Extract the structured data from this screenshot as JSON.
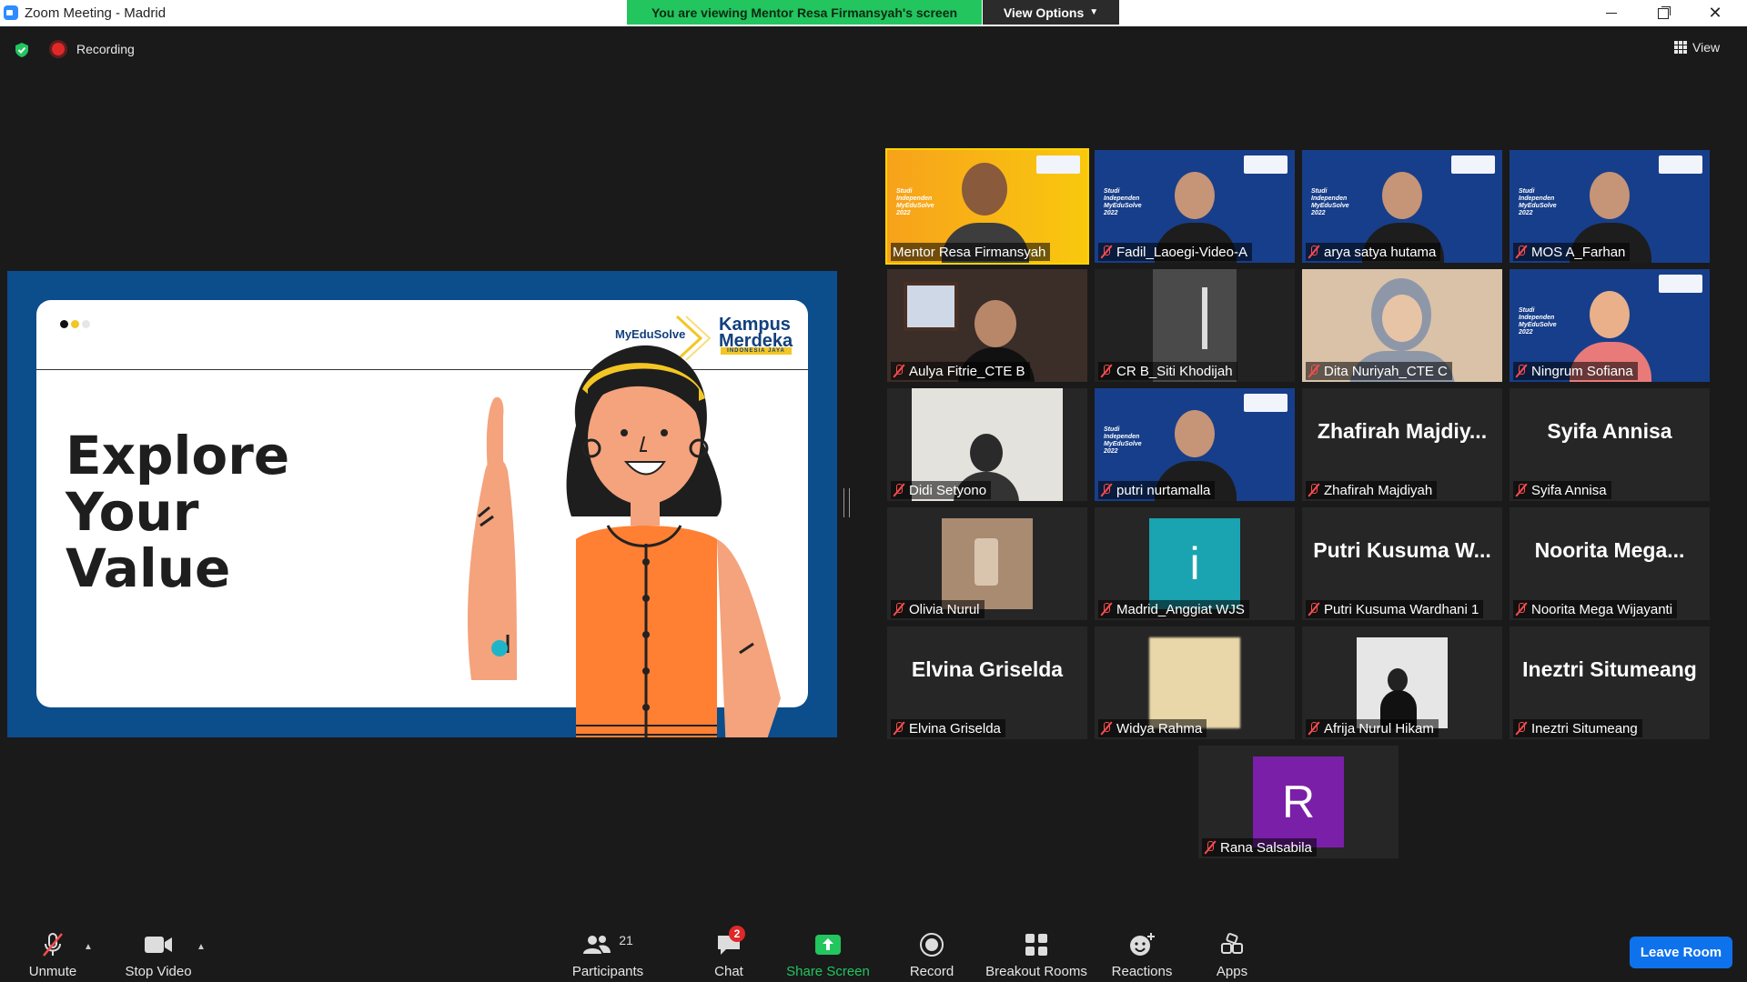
{
  "window": {
    "title": "Zoom Meeting - Madrid"
  },
  "banner": {
    "text": "You are viewing Mentor Resa Firmansyah's screen",
    "view_options": "View Options"
  },
  "status": {
    "recording": "Recording",
    "view": "View"
  },
  "slide": {
    "brand1": "MyEduSolve",
    "brand2_line1": "Kampus",
    "brand2_line2": "Merdeka",
    "brand2_sub": "INDONESIA JAYA",
    "headline": "Explore\nYour\nValue"
  },
  "participants": [
    {
      "name": "Mentor Resa Firmansyah",
      "muted": false,
      "active": true,
      "video": "yellow"
    },
    {
      "name": "Fadil_Laoegi-Video-A",
      "muted": true,
      "video": "blue"
    },
    {
      "name": "arya satya hutama",
      "muted": true,
      "video": "blue"
    },
    {
      "name": "MOS A_Farhan",
      "muted": true,
      "video": "blue"
    },
    {
      "name": "Aulya Fitrie_CTE B",
      "muted": true,
      "video": "room"
    },
    {
      "name": "CR B_Siti Khodijah",
      "muted": true,
      "video": "dark"
    },
    {
      "name": "Dita Nuriyah_CTE C",
      "muted": true,
      "video": "light"
    },
    {
      "name": "Ningrum Sofiana",
      "muted": true,
      "video": "blue-pink"
    },
    {
      "name": "Didi Setyono",
      "muted": true,
      "video": "small-white"
    },
    {
      "name": "putri nurtamalla",
      "muted": true,
      "video": "blue"
    },
    {
      "name": "Zhafirah Majdiyah",
      "muted": true,
      "video": "none",
      "big": "Zhafirah  Majdiy..."
    },
    {
      "name": "Syifa Annisa",
      "muted": true,
      "video": "none",
      "big": "Syifa Annisa"
    },
    {
      "name": "Olivia Nurul",
      "muted": true,
      "video": "small-brown"
    },
    {
      "name": "Madrid_Anggiat WJS",
      "muted": true,
      "video": "small-teal",
      "avatar": "i"
    },
    {
      "name": "Putri Kusuma Wardhani 1",
      "muted": true,
      "video": "none",
      "big": "Putri Kusuma W..."
    },
    {
      "name": "Noorita Mega Wijayanti",
      "muted": true,
      "video": "none",
      "big": "Noorita  Mega..."
    },
    {
      "name": "Elvina Griselda",
      "muted": true,
      "video": "none",
      "big": "Elvina Griselda"
    },
    {
      "name": "Widya Rahma",
      "muted": true,
      "video": "small-beige"
    },
    {
      "name": "Afrija Nurul Hikam",
      "muted": true,
      "video": "small-gray"
    },
    {
      "name": "Ineztri Situmeang",
      "muted": true,
      "video": "none",
      "big": "Ineztri Situmeang"
    },
    {
      "name": "Rana Salsabila",
      "muted": true,
      "video": "small-purple",
      "avatar": "R"
    }
  ],
  "toolbar": {
    "unmute": "Unmute",
    "stop_video": "Stop Video",
    "participants": "Participants",
    "participants_count": "21",
    "chat": "Chat",
    "chat_badge": "2",
    "share": "Share Screen",
    "record": "Record",
    "breakout": "Breakout Rooms",
    "reactions": "Reactions",
    "apps": "Apps",
    "leave": "Leave Room"
  },
  "colors": {
    "banner_green": "#22c55e",
    "leave_blue": "#0e72ed",
    "share_green": "#22c55e",
    "active_border": "#ffd400",
    "slide_frame": "#0c4d8c"
  }
}
